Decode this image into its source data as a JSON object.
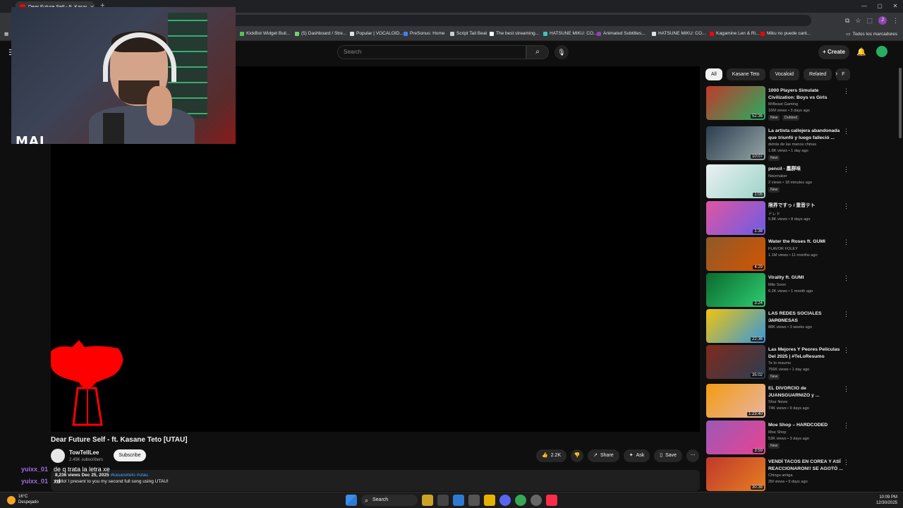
{
  "browser": {
    "tab_title": "Dear Future Self - ft. Kasane Te",
    "bookmarks": [
      {
        "label": "KickBot Widget Buil...",
        "color": "#53c353"
      },
      {
        "label": "(5) Dashboard / Stre...",
        "color": "#6fd46f"
      },
      {
        "label": "Popular | VOCALOID...",
        "color": "#e0e0e0"
      },
      {
        "label": "PreSonus: Home",
        "color": "#3b82f6"
      },
      {
        "label": "Script Tail Beat",
        "color": "#cccccc"
      },
      {
        "label": "The best streaming...",
        "color": "#ffffff"
      },
      {
        "label": "HATSUNE MIKU: CO...",
        "color": "#39c5bb"
      },
      {
        "label": "Animated Subtitles...",
        "color": "#8e44ad"
      },
      {
        "label": "HATSUNE MIKU: CO...",
        "color": "#e0e0e0"
      },
      {
        "label": "Kagamine Len & Ri...",
        "color": "#ff0000"
      },
      {
        "label": "Miku no puede cant...",
        "color": "#ff0000"
      }
    ],
    "all_bookmarks": "Todos los marcadores"
  },
  "header": {
    "search_placeholder": "Search",
    "create_label": "Create"
  },
  "overlay": {
    "brand": "MAI"
  },
  "video": {
    "title": "Dear Future Self - ft. Kasane Teto [UTAU]",
    "channel": "TowTellLee",
    "subscribers": "2.45K subscribers",
    "subscribe_label": "Subscribe",
    "likes": "2.2K",
    "share_label": "Share",
    "ask_label": "Ask",
    "save_label": "Save",
    "meta": "8,236 views  Dec 25, 2025",
    "tags": "#kasaneteto #utau",
    "description": "Hello! I present to you my second full song using UTAU!"
  },
  "chat": [
    {
      "user": "yuixx_01",
      "msg": "de q trata la letra xe"
    },
    {
      "user": "yuixx_01",
      "msg": "xd"
    }
  ],
  "sidebar": {
    "chips": [
      "All",
      "Kasane Teto",
      "Vocaloid",
      "Related",
      "F"
    ],
    "videos": [
      {
        "title": "1000 Players Simulate Civilization: Boys vs Girls",
        "channel": "MrBeast Gaming",
        "views": "16M views • 3 days ago",
        "badge": "New",
        "extra": "Dubbed",
        "duration": "52:36",
        "c1": "#c0392b",
        "c2": "#27ae60"
      },
      {
        "title": "La artista callejera abandonada que triunfó y luego falleció ...",
        "channel": "detrás de las manos chinas",
        "views": "1.8K views • 1 day ago",
        "badge": "New",
        "duration": "10:07",
        "c1": "#2c3e50",
        "c2": "#95a5a6"
      },
      {
        "title": "pencil - 鳳群味",
        "channel": "Noizmaker",
        "views": "2 views • 18 minutes ago",
        "badge": "New",
        "duration": "1:05",
        "c1": "#ecf0f1",
        "c2": "#9bd4c9"
      },
      {
        "title": "限界ですっ / 重音テト",
        "channel": "ドレド",
        "views": "5.8K views • 8 days ago",
        "duration": "1:38",
        "c1": "#e056a0",
        "c2": "#6c5ce7"
      },
      {
        "title": "Water the Roses ft. GUMI",
        "channel": "FLAVOR FOLEY",
        "views": "1.1M views • 11 months ago",
        "duration": "4:29",
        "c1": "#8e5a2b",
        "c2": "#d35400"
      },
      {
        "title": "Virality ft. GUMI",
        "channel": "Milo Soon",
        "views": "6.2K views • 1 month ago",
        "duration": "3:24",
        "c1": "#0b6b2e",
        "c2": "#2ecc71"
      },
      {
        "title": "LAS REDES SOCIALES JAPONESAS",
        "channel": "Laerion",
        "views": "88K views • 3 weeks ago",
        "duration": "22:36",
        "c1": "#f1c40f",
        "c2": "#3498db"
      },
      {
        "title": "Las Mejores Y Peores Películas Del 2025 | #TeLoResumo",
        "channel": "Te lo resumo",
        "views": "756K views • 1 day ago",
        "badge": "New",
        "duration": "35:02",
        "c1": "#7f2a1d",
        "c2": "#2c3e50"
      },
      {
        "title": "EL DIVORCIO de JUANSGUARNIZO y ...",
        "channel": "Shur News",
        "views": "74K views • 9 days ago",
        "duration": "1:23:40",
        "c1": "#f39c12",
        "c2": "#e8b4a0"
      },
      {
        "title": "Moe Shop – HARDCODED",
        "channel": "Moe Shop",
        "views": "53K views • 3 days ago",
        "badge": "New",
        "duration": "3:59",
        "c1": "#9b59b6",
        "c2": "#e84393"
      },
      {
        "title": "VENDÍ TACOS EN COREA Y ASÍ REACCIONARON!! SE AGOTÓ ...",
        "channel": "Chingu amiga",
        "views": "2M views • 9 days ago",
        "duration": "30:38",
        "c1": "#c0392b",
        "c2": "#e67e22"
      }
    ]
  },
  "taskbar": {
    "temp": "16°C",
    "weather": "Despejado",
    "search_label": "Search",
    "time": "10:09 PM",
    "date": "12/30/2025"
  }
}
